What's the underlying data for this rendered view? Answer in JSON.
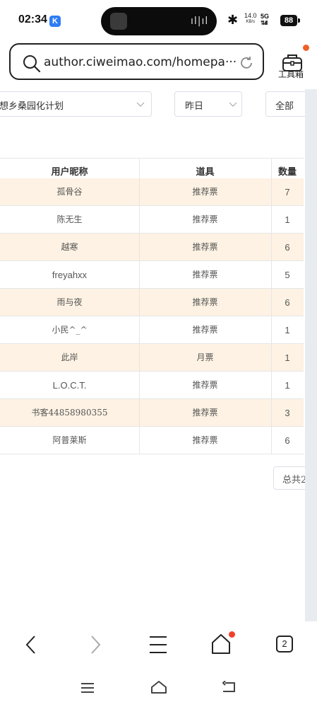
{
  "status_bar": {
    "time": "02:34",
    "app_badge": "K",
    "net_speed_value": "14.0",
    "net_speed_unit": "KB/s",
    "network": "5G",
    "battery": "88"
  },
  "browser": {
    "url": "author.ciweimao.com/homepa···",
    "toolbox_label": "工具箱"
  },
  "filters": {
    "book": "想乡桑园化计划",
    "date": "昨日",
    "scope": "全部"
  },
  "table": {
    "columns": [
      "用户昵称",
      "道具",
      "数量"
    ],
    "rows": [
      {
        "user": "孤骨谷",
        "item": "推荐票",
        "qty": "7"
      },
      {
        "user": "陈无生",
        "item": "推荐票",
        "qty": "1"
      },
      {
        "user": "越寒",
        "item": "推荐票",
        "qty": "6"
      },
      {
        "user": "freyahxx",
        "item": "推荐票",
        "qty": "5"
      },
      {
        "user": "雨与夜",
        "item": "推荐票",
        "qty": "6"
      },
      {
        "user": "小民^_^",
        "item": "推荐票",
        "qty": "1"
      },
      {
        "user": "此岸",
        "item": "月票",
        "qty": "1"
      },
      {
        "user": "L.O.C.T.",
        "item": "推荐票",
        "qty": "1"
      },
      {
        "user": "书客44858980355",
        "item": "推荐票",
        "qty": "3"
      },
      {
        "user": "阿普莱斯",
        "item": "推荐票",
        "qty": "6"
      }
    ]
  },
  "pagination": {
    "total_text": "总共2"
  },
  "bottom_nav": {
    "tab_count": "2"
  },
  "colors": {
    "row_highlight": "#fdf2e3",
    "notification_dot": "#f0602a",
    "badge_blue": "#2f7cf6"
  }
}
